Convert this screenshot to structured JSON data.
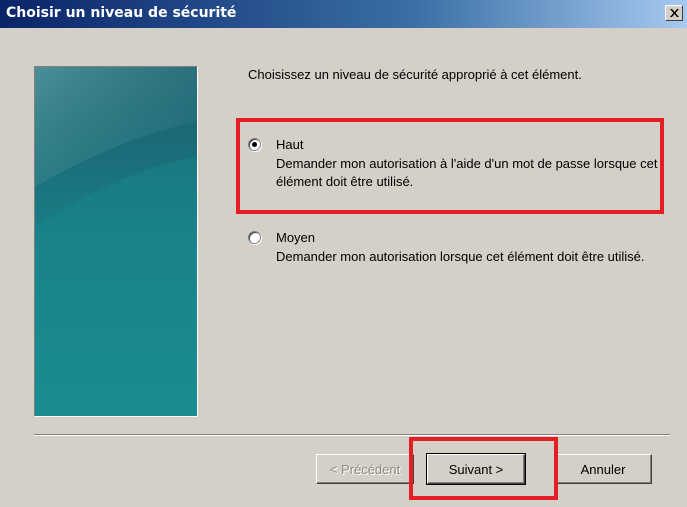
{
  "window": {
    "title": "Choisir un niveau de sécurité"
  },
  "prompt": "Choisissez un niveau de sécurité approprié à cet élément.",
  "options": [
    {
      "label": "Haut",
      "description": "Demander mon autorisation à l'aide d'un mot de passe lorsque cet élément doit être utilisé.",
      "selected": true
    },
    {
      "label": "Moyen",
      "description": "Demander mon autorisation lorsque cet élément doit être utilisé.",
      "selected": false
    }
  ],
  "buttons": {
    "back": "< Précédent",
    "next": "Suivant >",
    "cancel": "Annuler"
  },
  "colors": {
    "highlight": "#e31e24",
    "titlebar": "#0a246a",
    "dialog_background": "#d4d0c8",
    "side_image": "#1f8a8e"
  }
}
